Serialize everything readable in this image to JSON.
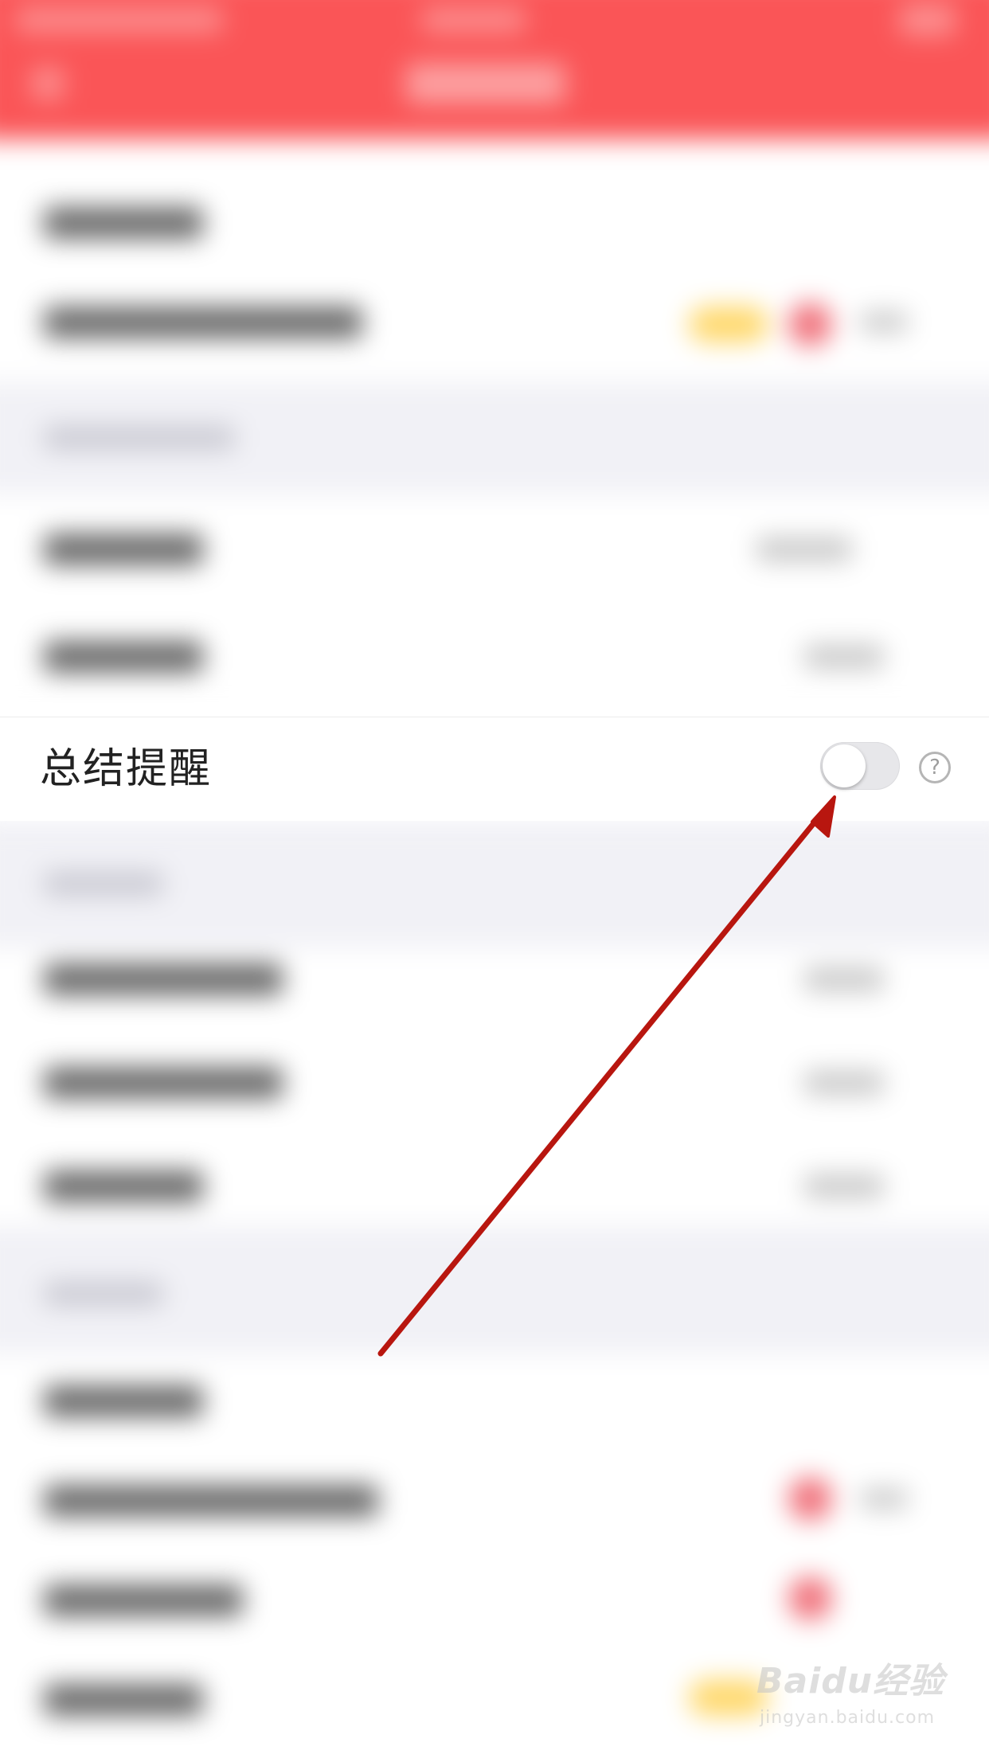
{
  "setting_row": {
    "label": "总结提醒",
    "toggle_on": false,
    "help_symbol": "?"
  },
  "watermark": {
    "logo": "Baidu经验",
    "url": "jingyan.baidu.com"
  },
  "colors": {
    "header_red": "#fa5557",
    "arrow_red": "#b8160f",
    "section_gray": "#f1f1f6",
    "toggle_off": "#e7e7ea"
  },
  "icons": {
    "help": "help-circle-icon",
    "annotation": "arrow-annotation"
  }
}
